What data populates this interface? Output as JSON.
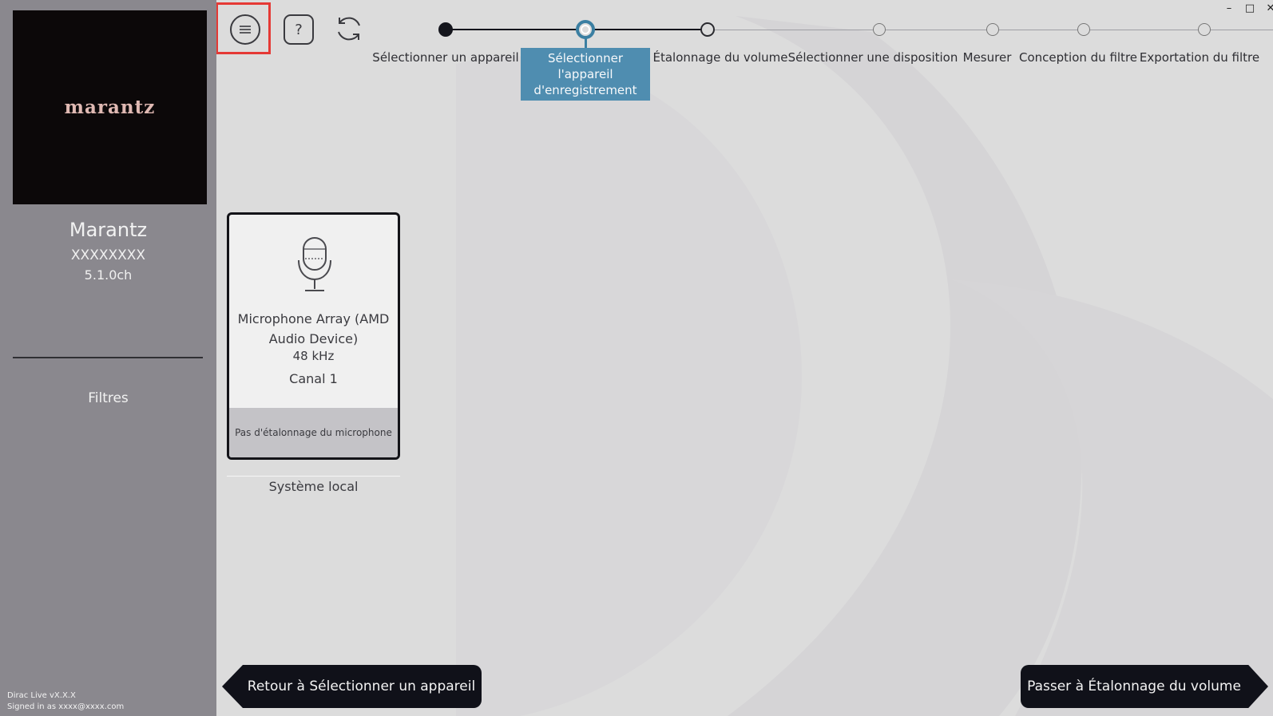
{
  "sidebar": {
    "logo_text": "marantz",
    "device_name": "Marantz",
    "device_model": "XXXXXXXX",
    "channels": "5.1.0ch",
    "filters_label": "Filtres",
    "version": "Dirac Live vX.X.X",
    "signed_in": "Signed in as xxxx@xxxx.com"
  },
  "toolbar": {
    "menu_icon": "menu-icon",
    "help_label": "?",
    "refresh_icon": "refresh-icon"
  },
  "window": {
    "minimize": "–",
    "maximize": "□",
    "close": "✕"
  },
  "steps": [
    {
      "label": "Sélectionner un appareil",
      "state": "done"
    },
    {
      "label": "Sélectionner l'appareil d'enregistrement",
      "state": "current"
    },
    {
      "label": "Étalonnage du volume",
      "state": "next"
    },
    {
      "label": "Sélectionner une disposition",
      "state": "pending"
    },
    {
      "label": "Mesurer",
      "state": "pending"
    },
    {
      "label": "Conception du filtre",
      "state": "pending"
    },
    {
      "label": "Exportation du filtre",
      "state": "pending"
    }
  ],
  "device_card": {
    "name": "Microphone Array (AMD Audio Device)",
    "sample_rate": "48 kHz",
    "channel": "Canal 1",
    "calibration": "Pas d'étalonnage du microphone",
    "icon": "microphone-icon"
  },
  "local_system_label": "Système local",
  "navigation": {
    "back_label": "Retour à Sélectionner un appareil",
    "next_label": "Passer à Étalonnage du volume"
  },
  "colors": {
    "sidebar_bg": "#8a888e",
    "main_bg": "#dcdcdc",
    "accent": "#4f8db0",
    "highlight": "#e53935",
    "button_bg": "#101119"
  }
}
